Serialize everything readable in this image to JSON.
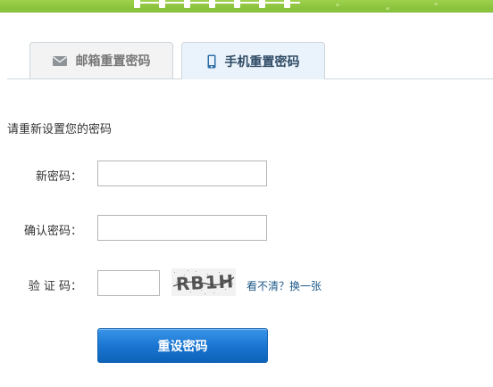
{
  "tabs": {
    "email": {
      "label": "邮箱重置密码",
      "icon": "mail-icon"
    },
    "phone": {
      "label": "手机重置密码",
      "icon": "phone-icon",
      "active": true
    }
  },
  "form": {
    "prompt": "请重新设置您的密码",
    "new_password_label": "新密码：",
    "confirm_password_label": "确认密码：",
    "captcha_label": "验 证 码：",
    "new_password_value": "",
    "confirm_password_value": "",
    "captcha_value": "",
    "captcha_text": "RB1H",
    "refresh_link": "看不清？换一张",
    "submit_label": "重设密码"
  },
  "colors": {
    "banner": "#8ec63f",
    "active_tab_bg": "#eaf3fb",
    "button": "#1a76d2",
    "link": "#1f5a8a"
  }
}
